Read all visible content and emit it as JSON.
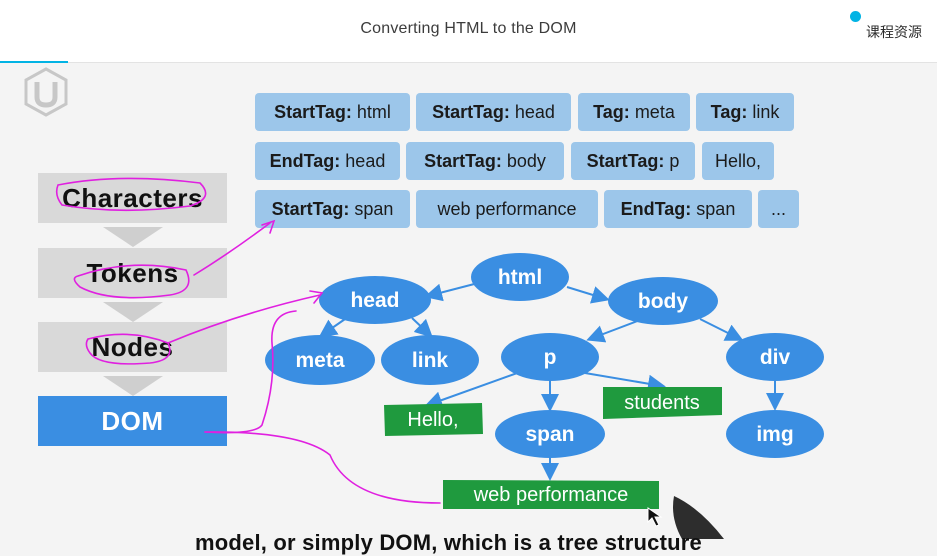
{
  "header": {
    "title": "Converting HTML to the DOM",
    "resources_label": "课程资源"
  },
  "tokens": [
    {
      "kind": "StartTag:",
      "value": " html"
    },
    {
      "kind": "StartTag:",
      "value": " head"
    },
    {
      "kind": "Tag:",
      "value": " meta"
    },
    {
      "kind": "Tag:",
      "value": " link"
    },
    {
      "kind": "EndTag:",
      "value": " head"
    },
    {
      "kind": "StartTag:",
      "value": " body"
    },
    {
      "kind": "StartTag:",
      "value": " p"
    },
    {
      "kind": "",
      "value": "Hello,"
    },
    {
      "kind": "StartTag:",
      "value": " span"
    },
    {
      "kind": "",
      "value": "web performance"
    },
    {
      "kind": "EndTag:",
      "value": " span"
    },
    {
      "kind": "",
      "value": "..."
    }
  ],
  "pipeline": [
    "Characters",
    "Tokens",
    "Nodes",
    "DOM"
  ],
  "tree": {
    "element_nodes": [
      "html",
      "head",
      "body",
      "meta",
      "link",
      "p",
      "div",
      "span",
      "img"
    ],
    "text_nodes": [
      "Hello,",
      "students",
      "web performance"
    ]
  },
  "subtitle": "model, or simply DOM, which is a tree structure",
  "colors": {
    "token_fill": "#9cc6ea",
    "node_fill": "#3a8ee2",
    "text_node_fill": "#1f9a3e",
    "annotation": "#e020e0",
    "accent": "#02b3e4"
  }
}
